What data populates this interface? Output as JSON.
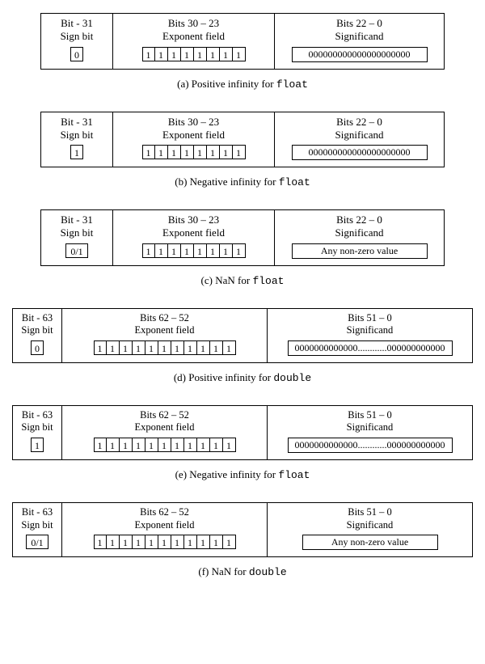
{
  "panels": [
    {
      "type": "float",
      "sign": {
        "h1": "Bit - 31",
        "h2": "Sign bit",
        "bits": [
          "0"
        ]
      },
      "exp": {
        "h1": "Bits 30 – 23",
        "h2": "Exponent field",
        "bits": [
          "1",
          "1",
          "1",
          "1",
          "1",
          "1",
          "1",
          "1"
        ]
      },
      "sig": {
        "h1": "Bits 22 – 0",
        "h2": "Significand",
        "text": "000000000000000000000"
      },
      "caption": {
        "prefix": "(a) Positive infinity for ",
        "mono": "float"
      }
    },
    {
      "type": "float",
      "sign": {
        "h1": "Bit - 31",
        "h2": "Sign bit",
        "bits": [
          "1"
        ]
      },
      "exp": {
        "h1": "Bits 30 – 23",
        "h2": "Exponent field",
        "bits": [
          "1",
          "1",
          "1",
          "1",
          "1",
          "1",
          "1",
          "1"
        ]
      },
      "sig": {
        "h1": "Bits 22 – 0",
        "h2": "Significand",
        "text": "000000000000000000000"
      },
      "caption": {
        "prefix": "(b) Negative infinity for ",
        "mono": "float"
      }
    },
    {
      "type": "float",
      "sign": {
        "h1": "Bit - 31",
        "h2": "Sign bit",
        "bits": [
          "0/1"
        ],
        "wide": true
      },
      "exp": {
        "h1": "Bits 30 – 23",
        "h2": "Exponent field",
        "bits": [
          "1",
          "1",
          "1",
          "1",
          "1",
          "1",
          "1",
          "1"
        ]
      },
      "sig": {
        "h1": "Bits 22 – 0",
        "h2": "Significand",
        "text": "Any non-zero value"
      },
      "caption": {
        "prefix": "(c) NaN for ",
        "mono": "float"
      }
    },
    {
      "type": "double",
      "sign": {
        "h1": "Bit - 63",
        "h2": "Sign bit",
        "bits": [
          "0"
        ]
      },
      "exp": {
        "h1": "Bits 62 – 52",
        "h2": "Exponent field",
        "bits": [
          "1",
          "1",
          "1",
          "1",
          "1",
          "1",
          "1",
          "1",
          "1",
          "1",
          "1"
        ]
      },
      "sig": {
        "h1": "Bits 51 – 0",
        "h2": "Significand",
        "text": "0000000000000............000000000000"
      },
      "caption": {
        "prefix": "(d) Positive infinity for ",
        "mono": "double"
      }
    },
    {
      "type": "double",
      "sign": {
        "h1": "Bit - 63",
        "h2": "Sign bit",
        "bits": [
          "1"
        ]
      },
      "exp": {
        "h1": "Bits 62 – 52",
        "h2": "Exponent field",
        "bits": [
          "1",
          "1",
          "1",
          "1",
          "1",
          "1",
          "1",
          "1",
          "1",
          "1",
          "1"
        ]
      },
      "sig": {
        "h1": "Bits 51 – 0",
        "h2": "Significand",
        "text": "0000000000000............000000000000"
      },
      "caption": {
        "prefix": "(e) Negative infinity for ",
        "mono": "float"
      }
    },
    {
      "type": "double",
      "sign": {
        "h1": "Bit - 63",
        "h2": "Sign bit",
        "bits": [
          "0/1"
        ],
        "wide": true
      },
      "exp": {
        "h1": "Bits 62 – 52",
        "h2": "Exponent field",
        "bits": [
          "1",
          "1",
          "1",
          "1",
          "1",
          "1",
          "1",
          "1",
          "1",
          "1",
          "1"
        ]
      },
      "sig": {
        "h1": "Bits 51 – 0",
        "h2": "Significand",
        "text": "Any non-zero value"
      },
      "caption": {
        "prefix": "(f) NaN for ",
        "mono": "double"
      }
    }
  ]
}
